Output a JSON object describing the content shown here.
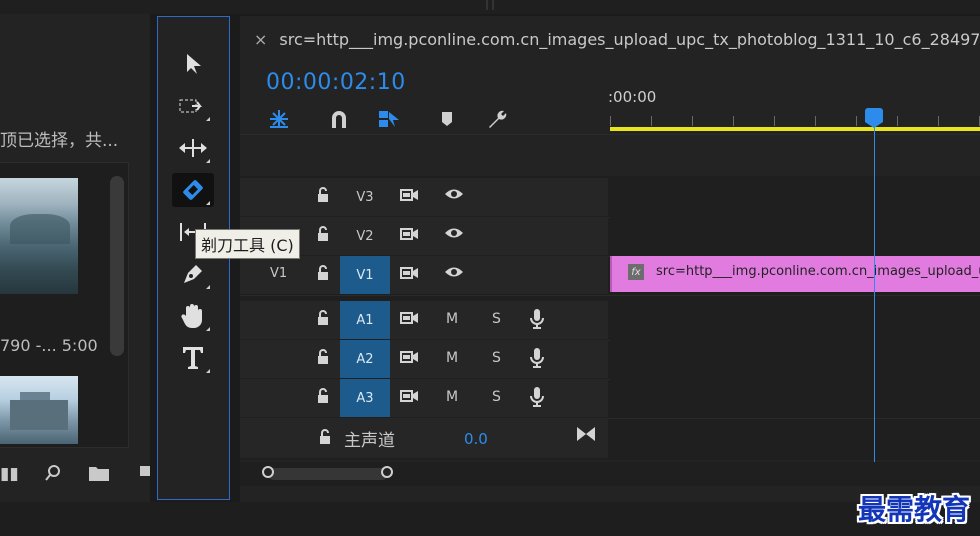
{
  "project_panel": {
    "selection_text": "顶已选择，共...",
    "duration_text": "790 -...  5:00"
  },
  "tools": {
    "tooltip": "剃刀工具 (C)",
    "items": [
      "selection-tool",
      "track-select-tool",
      "ripple-edit-tool",
      "razor-tool",
      "slip-tool",
      "pen-tool",
      "hand-tool",
      "type-tool"
    ]
  },
  "timeline": {
    "tab_close": "×",
    "sequence_name": "src=http___img.pconline.com.cn_images_upload_upc_tx_photoblog_1311_10_c6_28497",
    "timecode": "00:00:02:10",
    "ruler_start": ":00:00",
    "video_tracks": [
      {
        "label": "V3",
        "source": "",
        "targeted": false
      },
      {
        "label": "V2",
        "source": "",
        "targeted": false
      },
      {
        "label": "V1",
        "source": "V1",
        "targeted": true
      }
    ],
    "audio_tracks": [
      {
        "label": "A1",
        "mute": "M",
        "solo": "S",
        "targeted": true
      },
      {
        "label": "A2",
        "mute": "M",
        "solo": "S",
        "targeted": true
      },
      {
        "label": "A3",
        "mute": "M",
        "solo": "S",
        "targeted": true
      }
    ],
    "master": {
      "label": "主声道",
      "value": "0.0"
    },
    "clip": {
      "fx": "fx",
      "name": "src=http___img.pconline.com.cn_images_upload_upc"
    },
    "playhead_color": "#2d8ceb",
    "clip_color": "#e27be0",
    "work_area_color": "#e8e51f"
  },
  "watermark": "最需教育"
}
